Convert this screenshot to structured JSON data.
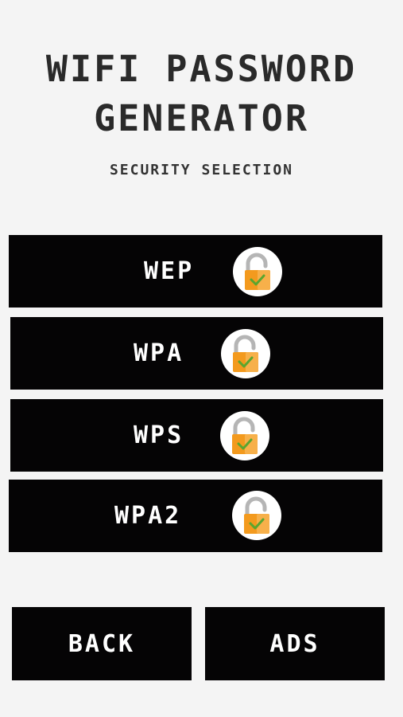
{
  "header": {
    "title_line1": "WIFI PASSWORD",
    "title_line2": "GENERATOR",
    "subtitle": "SECURITY SELECTION"
  },
  "options": [
    {
      "label": "WEP",
      "icon": "unlocked-padlock-icon"
    },
    {
      "label": "WPA",
      "icon": "unlocked-padlock-icon"
    },
    {
      "label": "WPS",
      "icon": "unlocked-padlock-icon"
    },
    {
      "label": "WPA2",
      "icon": "unlocked-padlock-icon"
    }
  ],
  "footer": {
    "back_label": "BACK",
    "ads_label": "ADS"
  },
  "colors": {
    "background": "#f4f4f4",
    "button": "#050405",
    "button_text": "#ffffff",
    "title_text": "#2a2a2a",
    "padlock_body": "#f39a1e",
    "padlock_shackle": "#b5b5b5",
    "checkmark": "#5aa62f"
  }
}
